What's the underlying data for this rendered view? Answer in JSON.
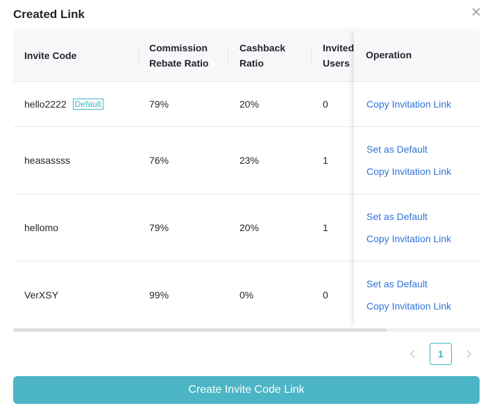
{
  "modal": {
    "title": "Created Link",
    "create_button_label": "Create Invite Code Link"
  },
  "table": {
    "headers": {
      "invite_code": "Invite Code",
      "commission_line1": "Commission",
      "commission_line2": "Rebate Ratio",
      "cashback_line1": "Cashback",
      "cashback_line2": "Ratio",
      "invited_line1": "Invited",
      "invited_line2": "Users",
      "operation": "Operation"
    },
    "default_badge": "Default",
    "rows": [
      {
        "code": "hello2222",
        "commission": "79%",
        "cashback": "20%",
        "invited": "0",
        "set_default": "",
        "copy_link": "Copy Invitation Link"
      },
      {
        "code": "heasassss",
        "commission": "76%",
        "cashback": "23%",
        "invited": "1",
        "set_default": "Set as Default",
        "copy_link": "Copy Invitation Link"
      },
      {
        "code": "hellomo",
        "commission": "79%",
        "cashback": "20%",
        "invited": "1",
        "set_default": "Set as Default",
        "copy_link": "Copy Invitation Link"
      },
      {
        "code": "VerXSY",
        "commission": "99%",
        "cashback": "0%",
        "invited": "0",
        "set_default": "Set as Default",
        "copy_link": "Copy Invitation Link"
      }
    ]
  },
  "pagination": {
    "current_page": "1"
  },
  "colors": {
    "accent": "#4bb5c5",
    "link": "#2f73da"
  }
}
